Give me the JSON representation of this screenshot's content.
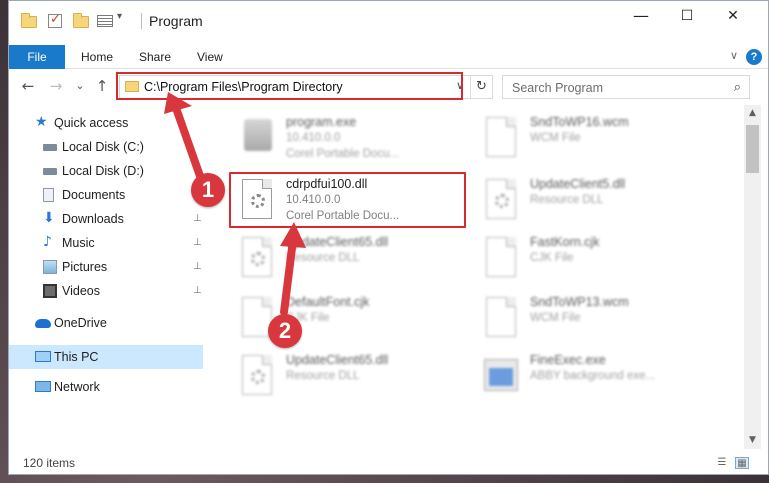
{
  "window": {
    "title": "Program"
  },
  "titlebar": {
    "minimize": "—",
    "maximize": "☐",
    "close": "✕"
  },
  "ribbon": {
    "tabs": [
      "File",
      "Home",
      "Share",
      "View"
    ],
    "help": "?",
    "collapse": "∨"
  },
  "nav": {
    "back": "←",
    "forward": "→",
    "recent": "⌄",
    "up": "↑",
    "address": "C:\\Program Files\\Program Directory",
    "search_placeholder": "Search Program",
    "dropdown": "∨",
    "refresh": "↻",
    "search_icon": "⌕"
  },
  "sidebar": {
    "items": [
      {
        "label": "Quick access",
        "icon": "star-icon"
      },
      {
        "label": "Local Disk (C:)",
        "icon": "drive-icon"
      },
      {
        "label": "Local Disk (D:)",
        "icon": "drive-icon"
      },
      {
        "label": "Documents",
        "icon": "documents-icon"
      },
      {
        "label": "Downloads",
        "icon": "downloads-icon"
      },
      {
        "label": "Music",
        "icon": "music-icon"
      },
      {
        "label": "Pictures",
        "icon": "pictures-icon"
      },
      {
        "label": "Videos",
        "icon": "videos-icon"
      },
      {
        "label": "OneDrive",
        "icon": "cloud-icon"
      },
      {
        "label": "This PC",
        "icon": "computer-icon"
      },
      {
        "label": "Network",
        "icon": "network-icon"
      }
    ],
    "pin": "📌"
  },
  "files": [
    {
      "name": "program.exe",
      "line2": "10.410.0.0",
      "line3": "Corel Portable Docu..."
    },
    {
      "name": "SndToWP16.wcm",
      "line2": "WCM File",
      "line3": ""
    },
    {
      "name": "cdrpdfui100.dll",
      "line2": "10.410.0.0",
      "line3": "Corel Portable Docu..."
    },
    {
      "name": "UpdateClient5.dll",
      "line2": "Resource DLL",
      "line3": ""
    },
    {
      "name": "UpdateClient65.dll",
      "line2": "Resource DLL",
      "line3": ""
    },
    {
      "name": "FastKorn.cjk",
      "line2": "CJK File",
      "line3": ""
    },
    {
      "name": "DefaultFont.cjk",
      "line2": "CJK File",
      "line3": ""
    },
    {
      "name": "SndToWP13.wcm",
      "line2": "WCM File",
      "line3": ""
    },
    {
      "name": "UpdateClient65.dll",
      "line2": "Resource DLL",
      "line3": ""
    },
    {
      "name": "FineExec.exe",
      "line2": "ABBY background exe...",
      "line3": ""
    }
  ],
  "annotations": {
    "badge1": "1",
    "badge2": "2",
    "accent": "#d8383d"
  },
  "status": {
    "count": "120 items"
  },
  "scroll": {
    "up": "▲",
    "down": "▼"
  }
}
